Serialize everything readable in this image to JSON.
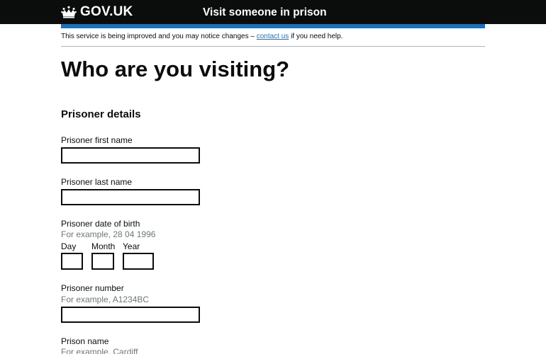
{
  "header": {
    "logo_text": "GOV.UK",
    "service_name": "Visit someone in prison",
    "brand_color": "#0b0c0c",
    "accent_color": "#1d70b8"
  },
  "phase_banner": {
    "text_before": "This service is being improved and you may notice changes – ",
    "link_text": "contact us",
    "text_after": " if you need help."
  },
  "page": {
    "title": "Who are you visiting?",
    "section_heading": "Prisoner details"
  },
  "fields": {
    "first_name": {
      "label": "Prisoner first name",
      "value": ""
    },
    "last_name": {
      "label": "Prisoner last name",
      "value": ""
    },
    "dob": {
      "label": "Prisoner date of birth",
      "hint": "For example, 28 04 1996",
      "day_label": "Day",
      "month_label": "Month",
      "year_label": "Year"
    },
    "prisoner_number": {
      "label": "Prisoner number",
      "hint": "For example, A1234BC",
      "value": ""
    },
    "prison_name": {
      "label": "Prison name",
      "hint": "For example, Cardiff"
    }
  },
  "icons": {
    "logo": "crown-icon"
  }
}
